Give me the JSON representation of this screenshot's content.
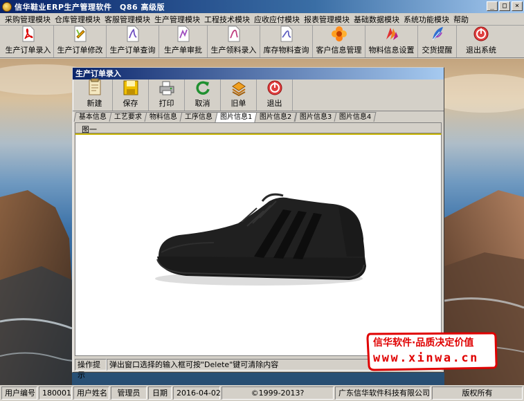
{
  "window": {
    "title": "信华鞋业ERP生产管理软件　Q86 高级版",
    "btn_min": "_",
    "btn_max": "□",
    "btn_close": "×"
  },
  "menu": [
    "采购管理模块",
    "仓库管理模块",
    "客服管理模块",
    "生产管理模块",
    "工程技术模块",
    "应收应付模块",
    "报表管理模块",
    "基础数据模块",
    "系统功能模块",
    "帮助"
  ],
  "toolbar": [
    {
      "label": "生产订单录入",
      "icon": "pdf-icon"
    },
    {
      "label": "生产订单修改",
      "icon": "edit-doc-icon"
    },
    {
      "label": "生产订单查询",
      "icon": "query-doc-icon"
    },
    {
      "label": "生产单审批",
      "icon": "approve-doc-icon"
    },
    {
      "label": "生产领料录入",
      "icon": "material-doc-icon"
    },
    {
      "label": "库存物料查询",
      "icon": "inventory-doc-icon"
    },
    {
      "label": "客户信息管理",
      "icon": "flower-icon"
    },
    {
      "label": "物料信息设置",
      "icon": "colorful-icon"
    },
    {
      "label": "交货提醒",
      "icon": "feather-icon"
    },
    {
      "label": "退出系统",
      "icon": "exit-icon"
    }
  ],
  "child": {
    "title": "生产订单录入",
    "toolbar": [
      {
        "label": "新建",
        "icon": "new-doc-icon"
      },
      {
        "label": "保存",
        "icon": "save-icon"
      },
      {
        "label": "打印",
        "icon": "printer-icon"
      },
      {
        "label": "取消",
        "icon": "refresh-icon"
      },
      {
        "label": "旧单",
        "icon": "old-order-icon"
      },
      {
        "label": "退出",
        "icon": "exit-icon"
      }
    ],
    "tabs": [
      "基本信息",
      "工艺要求",
      "物料信息",
      "工序信息",
      "图片信息1",
      "图片信息2",
      "图片信息3",
      "图片信息4"
    ],
    "active_tab": 4,
    "subtab": "图一",
    "status_label": "操作提示",
    "status_text": "弹出窗口选择的输入框可按\"Delete\"键可清除内容"
  },
  "promo": {
    "line1": "信华软件·品质决定价值",
    "line2": "www.xinwa.cn"
  },
  "statusbar": [
    {
      "text": "用户编号"
    },
    {
      "text": "180001"
    },
    {
      "text": "用户姓名"
    },
    {
      "text": "管理员"
    },
    {
      "text": "日期"
    },
    {
      "text": "2016-04-02"
    },
    {
      "text": "©1999-2013?"
    },
    {
      "text": "广东信华软件科技有限公司"
    },
    {
      "text": "版权所有"
    }
  ],
  "colors": {
    "title_blue": "#0a246a",
    "promo_red": "#e00000"
  }
}
